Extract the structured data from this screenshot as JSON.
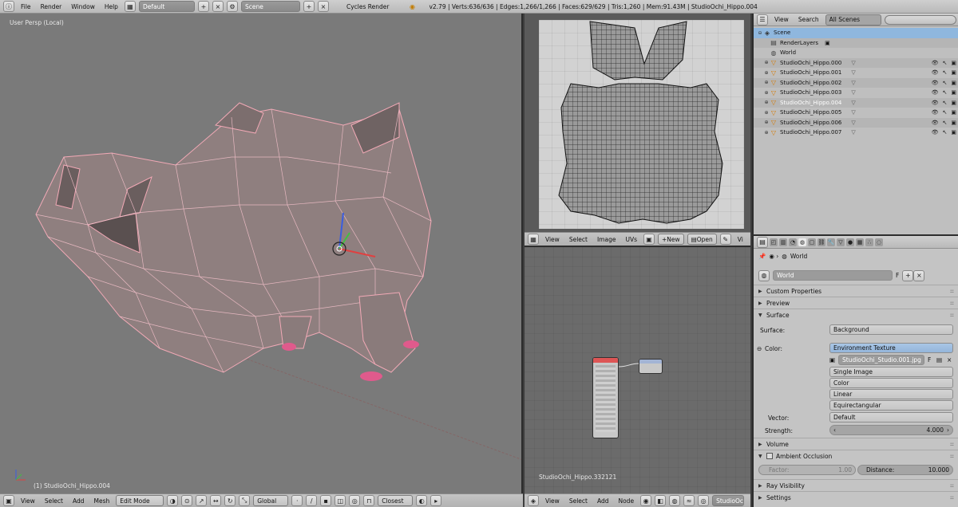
{
  "topbar": {
    "menus": [
      "File",
      "Render",
      "Window",
      "Help"
    ],
    "layout": "Default",
    "scene": "Scene",
    "engine": "Cycles Render",
    "info": "v2.79 | Verts:636/636 | Edges:1,266/1,266 | Faces:629/629 | Tris:1,260 | Mem:91.43M | StudioOchi_Hippo.004"
  },
  "viewport": {
    "label": "User Persp (Local)",
    "object": "(1) StudioOchi_Hippo.004",
    "footer": {
      "menus": [
        "View",
        "Select",
        "Add",
        "Mesh"
      ],
      "mode": "Edit Mode",
      "orientation": "Global",
      "snap": "Closest"
    }
  },
  "uv_editor": {
    "footer": {
      "menus": [
        "View",
        "Select",
        "Image",
        "UVs"
      ],
      "new_label": "New",
      "open_label": "Open",
      "trailing": "Vi"
    }
  },
  "node_editor": {
    "label": "StudioOchi_Hippo.332121",
    "footer": {
      "menus": [
        "View",
        "Select",
        "Add",
        "Node"
      ],
      "trailing": "StudioOchi"
    }
  },
  "outliner": {
    "header": {
      "view": "View",
      "search": "Search",
      "filter": "All Scenes"
    },
    "items": [
      {
        "name": "Scene",
        "indent": 0,
        "icon": "scene-icon"
      },
      {
        "name": "RenderLayers",
        "indent": 1,
        "icon": "render-layers-icon"
      },
      {
        "name": "World",
        "indent": 1,
        "icon": "world-icon"
      },
      {
        "name": "StudioOchi_Hippo.000",
        "indent": 1,
        "icon": "mesh-icon"
      },
      {
        "name": "StudioOchi_Hippo.001",
        "indent": 1,
        "icon": "mesh-icon"
      },
      {
        "name": "StudioOchi_Hippo.002",
        "indent": 1,
        "icon": "mesh-icon"
      },
      {
        "name": "StudioOchi_Hippo.003",
        "indent": 1,
        "icon": "mesh-icon"
      },
      {
        "name": "StudioOchi_Hippo.004",
        "indent": 1,
        "icon": "mesh-icon"
      },
      {
        "name": "StudioOchi_Hippo.005",
        "indent": 1,
        "icon": "mesh-icon"
      },
      {
        "name": "StudioOchi_Hippo.006",
        "indent": 1,
        "icon": "mesh-icon"
      },
      {
        "name": "StudioOchi_Hippo.007",
        "indent": 1,
        "icon": "mesh-icon"
      }
    ]
  },
  "properties": {
    "breadcrumb": "World",
    "world_name": "World",
    "world_fake_user": "F",
    "panels": {
      "custom": "Custom Properties",
      "preview": "Preview",
      "surface": "Surface",
      "volume": "Volume",
      "ao": "Ambient Occlusion",
      "ray": "Ray Visibility",
      "settings": "Settings"
    },
    "surface_label": "Surface:",
    "surface_value": "Background",
    "color_label": "Color:",
    "color_value": "Environment Texture",
    "image_name": "StudioOchi_Studio.001.jpg",
    "image_fake": "F",
    "image_source": "Single Image",
    "color_space": "Color",
    "interpolation": "Linear",
    "projection": "Equirectangular",
    "vector_label": "Vector:",
    "vector_value": "Default",
    "strength_label": "Strength:",
    "strength_value": "4.000",
    "factor_label": "Factor:",
    "factor_value": "1.00",
    "distance_label": "Distance:",
    "distance_value": "10.000"
  }
}
